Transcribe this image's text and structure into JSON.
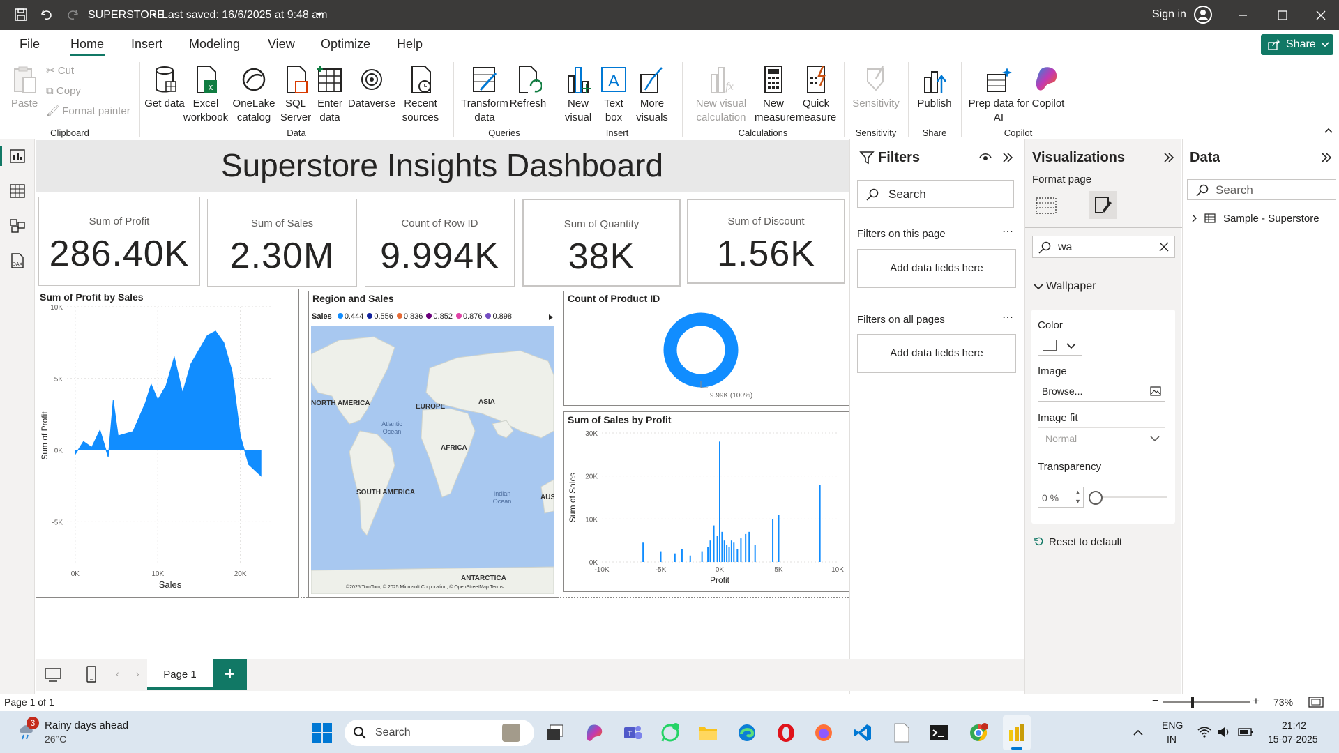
{
  "titlebar": {
    "title": "SUPERSTORE",
    "saved": "Last saved: 16/6/2025 at 9:48 am",
    "sign_in": "Sign in"
  },
  "menu": {
    "items": [
      "File",
      "Home",
      "Insert",
      "Modeling",
      "View",
      "Optimize",
      "Help"
    ],
    "share": "Share"
  },
  "ribbon": {
    "clipboard": {
      "paste": "Paste",
      "cut": "Cut",
      "copy": "Copy",
      "format_painter": "Format painter",
      "group": "Clipboard"
    },
    "data": {
      "get_data": "Get data",
      "excel": "Excel workbook",
      "onelake": "OneLake catalog",
      "sql": "SQL Server",
      "enter": "Enter data",
      "dataverse": "Dataverse",
      "recent": "Recent sources",
      "group": "Data"
    },
    "queries": {
      "transform": "Transform data",
      "refresh": "Refresh",
      "group": "Queries"
    },
    "insert": {
      "new_visual": "New visual",
      "text_box": "Text box",
      "more_visuals": "More visuals",
      "group": "Insert"
    },
    "calculations": {
      "new_visual_calc": "New visual calculation",
      "new_measure": "New measure",
      "quick_measure": "Quick measure",
      "group": "Calculations"
    },
    "sensitivity": {
      "label": "Sensitivity",
      "group": "Sensitivity"
    },
    "share": {
      "publish": "Publish",
      "group": "Share"
    },
    "copilot": {
      "prep": "Prep data for AI",
      "copilot": "Copilot",
      "group": "Copilot"
    }
  },
  "dashboard": {
    "title": "Superstore Insights Dashboard",
    "cards": [
      {
        "label": "Sum of Profit",
        "value": "286.40K"
      },
      {
        "label": "Sum of Sales",
        "value": "2.30M"
      },
      {
        "label": "Count of Row ID",
        "value": "9.994K"
      },
      {
        "label": "Sum of Quantity",
        "value": "38K"
      },
      {
        "label": "Sum of Discount",
        "value": "1.56K"
      }
    ],
    "map": {
      "title": "Region and Sales",
      "legend_title": "Sales",
      "legend": [
        {
          "v": "0.444",
          "c": "#118dff"
        },
        {
          "v": "0.556",
          "c": "#12239e"
        },
        {
          "v": "0.836",
          "c": "#e66c37"
        },
        {
          "v": "0.852",
          "c": "#6b007b"
        },
        {
          "v": "0.876",
          "c": "#e044a7"
        },
        {
          "v": "0.898",
          "c": "#744ec2"
        }
      ],
      "labels": [
        "NORTH AMERICA",
        "EUROPE",
        "ASIA",
        "Atlantic Ocean",
        "AFRICA",
        "SOUTH AMERICA",
        "Indian Ocean",
        "AUS",
        "ANTARCTICA"
      ],
      "attribution": "©2025 TomTom, © 2025 Microsoft Corporation, © OpenStreetMap  Terms"
    },
    "donut": {
      "title": "Count of Product ID",
      "label": "9.99K (100%)"
    }
  },
  "chart_data": [
    {
      "type": "area",
      "title": "Sum of Profit by Sales",
      "xlabel": "Sales",
      "ylabel": "Sum of Profit",
      "x_ticks": [
        "0K",
        "10K",
        "20K"
      ],
      "y_ticks": [
        "10K",
        "5K",
        "0K",
        "-5K"
      ],
      "xlim": [
        -1000,
        24000
      ],
      "ylim": [
        -8000,
        10000
      ],
      "series": [
        {
          "x": [
            0,
            1000,
            2000,
            3000,
            4000,
            4600,
            5200,
            7000,
            8500,
            9200,
            10000,
            11000,
            12000,
            13000,
            14000,
            15000,
            16000,
            17000,
            18000,
            19000,
            20000,
            21000,
            22500
          ],
          "y": [
            -300,
            600,
            200,
            1400,
            -500,
            3500,
            1000,
            1300,
            3300,
            4600,
            3500,
            4500,
            6500,
            4000,
            6000,
            7000,
            8000,
            8300,
            7500,
            5500,
            1000,
            -1000,
            -1800
          ]
        }
      ],
      "color": "#118dff"
    },
    {
      "type": "bar",
      "title": "Sum of Sales by Profit",
      "xlabel": "Profit",
      "ylabel": "Sum of Sales",
      "x_ticks": [
        "-10K",
        "-5K",
        "0K",
        "5K",
        "10K"
      ],
      "y_ticks": [
        "30K",
        "20K",
        "10K",
        "0K"
      ],
      "xlim": [
        -10000,
        10000
      ],
      "ylim": [
        0,
        30000
      ],
      "x": [
        -6500,
        -5000,
        -3800,
        -3200,
        -2500,
        -1500,
        -1000,
        -800,
        -500,
        -200,
        0,
        200,
        400,
        600,
        800,
        1000,
        1200,
        1500,
        1800,
        2200,
        2500,
        3000,
        4500,
        5000,
        8500
      ],
      "values": [
        4500,
        2500,
        2000,
        3000,
        1500,
        2500,
        3500,
        5000,
        8500,
        6000,
        28000,
        7000,
        5000,
        4000,
        3500,
        5000,
        4500,
        3000,
        5500,
        6500,
        7000,
        4000,
        10000,
        11000,
        18000
      ],
      "color": "#118dff"
    }
  ],
  "filters": {
    "title": "Filters",
    "search_placeholder": "Search",
    "on_page": "Filters on this page",
    "on_all": "Filters on all pages",
    "add_fields": "Add data fields here"
  },
  "viz": {
    "title": "Visualizations",
    "format_page": "Format page",
    "search_value": "wa",
    "section": "Wallpaper",
    "color_label": "Color",
    "image_label": "Image",
    "browse": "Browse...",
    "image_fit_label": "Image fit",
    "image_fit_value": "Normal",
    "transparency_label": "Transparency",
    "transparency_value": "0 %",
    "reset": "Reset to default"
  },
  "data_pane": {
    "title": "Data",
    "search_placeholder": "Search",
    "table": "Sample - Superstore"
  },
  "pages": {
    "tab": "Page 1",
    "add": "+"
  },
  "status": {
    "page": "Page 1 of 1",
    "zoom": "73%"
  },
  "taskbar": {
    "weather_title": "Rainy days ahead",
    "weather_temp": "26°C",
    "weather_badge": "3",
    "search": "Search",
    "lang": "ENG",
    "region": "IN",
    "time": "21:42",
    "date": "15-07-2025"
  }
}
